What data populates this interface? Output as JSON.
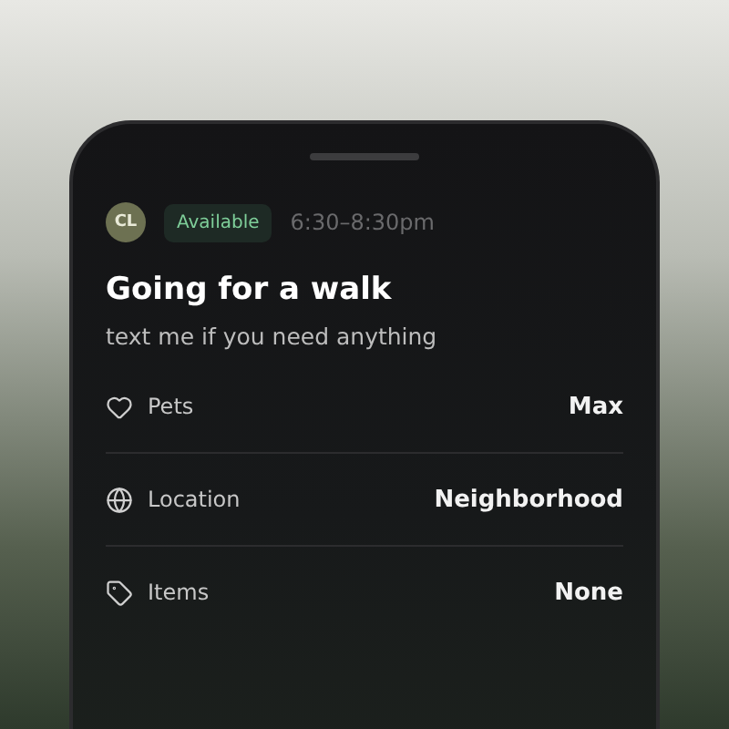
{
  "status": {
    "avatar": "CL",
    "badge": "Available",
    "time": "6:30–8:30pm"
  },
  "title": "Going for a walk",
  "subtitle": "text me if you need anything",
  "details": [
    {
      "label": "Pets",
      "value": "Max"
    },
    {
      "label": "Location",
      "value": "Neighborhood"
    },
    {
      "label": "Items",
      "value": "None"
    }
  ]
}
